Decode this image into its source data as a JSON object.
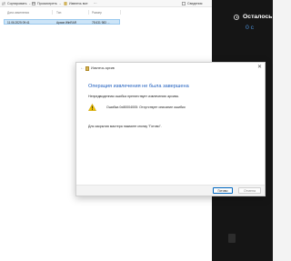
{
  "toolbar": {
    "sort_label": "Сортировать",
    "view_label": "Просмотреть",
    "extract_label": "Извлечь все",
    "details_label": "Сведения"
  },
  "columns": {
    "date": "Дата изменения",
    "type": "Тип",
    "size": "Размер"
  },
  "file_row": {
    "date": "11.06.2025 09:41",
    "type": "Архив WinRAR",
    "size": "78 631 983 ..."
  },
  "side_panel": {
    "remaining_label": "Осталось:",
    "remaining_value": "0 с"
  },
  "dialog": {
    "window_title": "Извлечь архив",
    "heading": "Операция извлечения не была завершена",
    "message": "Непредвиденная ошибка препятствует извлечению архива.",
    "error_text": "Ошибка 0x80004005: Отсутствует описание ошибки",
    "finish_hint": "Для закрытия мастера нажмите кнопку \"Готово\".",
    "done_button": "Готово",
    "cancel_button": "Отмена"
  },
  "colors": {
    "accent": "#0067c0",
    "heading": "#1f5fbf",
    "side_panel_bg": "#151515",
    "remaining_value": "#4a8fd8"
  }
}
